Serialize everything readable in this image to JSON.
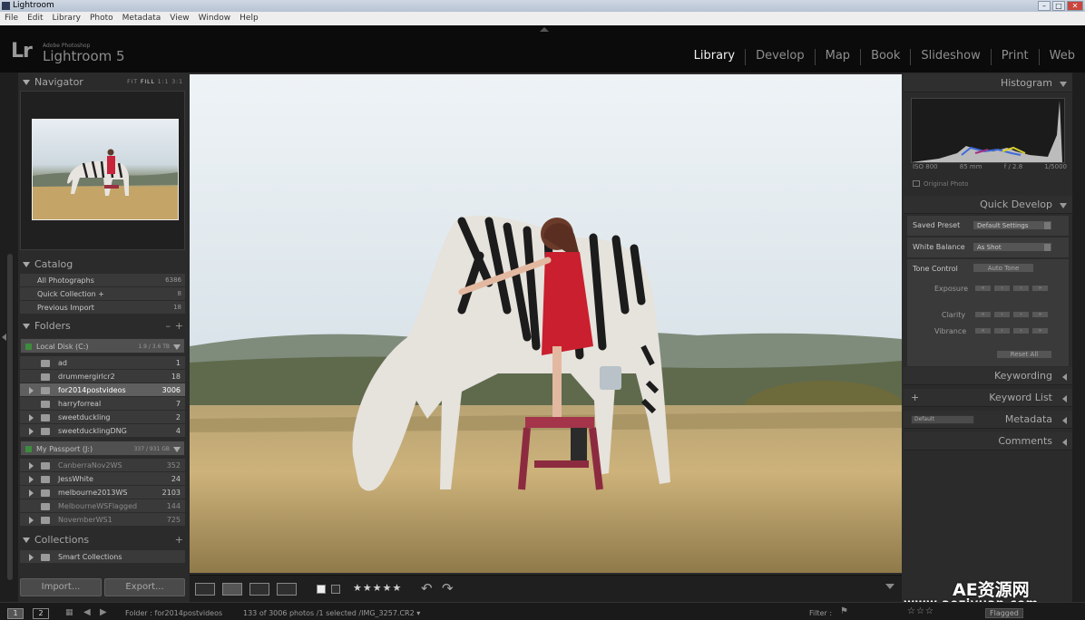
{
  "window": {
    "title": "Lightroom"
  },
  "menubar": [
    "File",
    "Edit",
    "Library",
    "Photo",
    "Metadata",
    "View",
    "Window",
    "Help"
  ],
  "identity": {
    "adobe": "Adobe Photoshop",
    "product": "Lightroom 5",
    "logo": "Lr"
  },
  "modules": {
    "active": "Library",
    "items": [
      "Library",
      "Develop",
      "Map",
      "Book",
      "Slideshow",
      "Print",
      "Web"
    ]
  },
  "navigator": {
    "title": "Navigator",
    "options": {
      "fit": "FIT",
      "fill": "FILL",
      "one": "1:1",
      "ratio": "3:1"
    }
  },
  "catalog": {
    "title": "Catalog",
    "items": [
      {
        "label": "All Photographs",
        "count": "6386"
      },
      {
        "label": "Quick Collection +",
        "count": "8"
      },
      {
        "label": "Previous Import",
        "count": "18"
      }
    ]
  },
  "folders": {
    "title": "Folders",
    "plus": "+",
    "minus": "–",
    "volume1": {
      "name": "Local Disk (C:)",
      "capacity": "1.9 / 3.6 TB"
    },
    "volume1_items": [
      {
        "label": "ad",
        "count": "1"
      },
      {
        "label": "drummergirlcr2",
        "count": "18"
      },
      {
        "label": "for2014postvideos",
        "count": "3006"
      },
      {
        "label": "harryforreal",
        "count": "7"
      },
      {
        "label": "sweetduckling",
        "count": "2"
      },
      {
        "label": "sweetducklingDNG",
        "count": "4"
      }
    ],
    "volume2": {
      "name": "My Passport (J:)",
      "capacity": "337 / 931 GB"
    },
    "volume2_items": [
      {
        "label": "CanberraNov2WS",
        "count": "352"
      },
      {
        "label": "JessWhite",
        "count": "24"
      },
      {
        "label": "melbourne2013WS",
        "count": "2103"
      },
      {
        "label": "MelbourneWSFlagged",
        "count": "144"
      },
      {
        "label": "NovemberWS1",
        "count": "725"
      }
    ]
  },
  "collections": {
    "title": "Collections",
    "plus": "+",
    "items": [
      {
        "label": "Smart Collections"
      }
    ]
  },
  "leftButtons": {
    "import": "Import...",
    "export": "Export..."
  },
  "histogram": {
    "title": "Histogram",
    "iso": "ISO 800",
    "focal": "85 mm",
    "aperture": "f / 2.8",
    "shutter": "1/5000",
    "original_photo": "Original Photo"
  },
  "quickDevelop": {
    "title": "Quick Develop",
    "saved_preset_label": "Saved Preset",
    "saved_preset_value": "Default Settings",
    "white_balance_label": "White Balance",
    "white_balance_value": "As Shot",
    "tone_control_label": "Tone Control",
    "auto_tone": "Auto Tone",
    "exposure": "Exposure",
    "clarity": "Clarity",
    "vibrance": "Vibrance",
    "reset_all": "Reset All"
  },
  "rightPanels": {
    "keywording": "Keywording",
    "keywordList": "Keyword List",
    "keywordListPlus": "+",
    "metadata": "Metadata",
    "metadataPreset": "Default",
    "comments": "Comments"
  },
  "toolbar": {
    "stars": "★★★★★"
  },
  "statusbar": {
    "tab1": "1",
    "tab2": "2",
    "path": "Folder : for2014postvideos",
    "info": "133 of 3006 photos /1 selected /IMG_3257.CR2 ▾",
    "filter": "Filter :",
    "filter_value": "Flagged"
  },
  "watermark": {
    "name": "AE资源网",
    "url": "www.aeziyuan.com"
  },
  "colors": {
    "panel": "#2b2b2b",
    "idplate": "#0b0b0b",
    "activeModule": "#f0f0f0",
    "selectedFolder": "#5f5f5f"
  }
}
